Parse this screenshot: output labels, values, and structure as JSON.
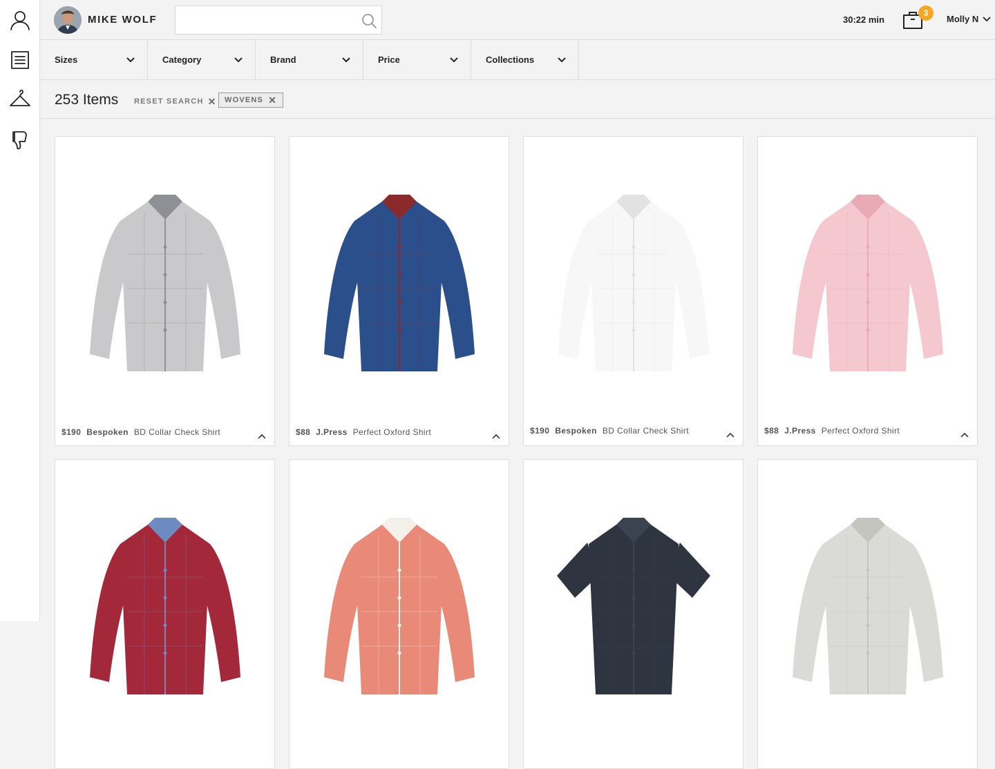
{
  "client": {
    "name": "MIKE WOLF"
  },
  "search": {
    "value": "",
    "placeholder": ""
  },
  "session": {
    "timer": "30:22 min"
  },
  "cart": {
    "count": "3"
  },
  "user": {
    "name": "Molly N"
  },
  "filters": [
    {
      "label": "Sizes"
    },
    {
      "label": "Category"
    },
    {
      "label": "Brand"
    },
    {
      "label": "Price"
    },
    {
      "label": "Collections"
    }
  ],
  "results": {
    "count_label": "253 Items",
    "reset_label": "RESET SEARCH",
    "chips": [
      {
        "label": "WOVENS"
      }
    ]
  },
  "icons": {
    "rail": [
      "client-icon",
      "notes-icon",
      "hanger-icon",
      "dislike-icon"
    ],
    "search": "search-icon",
    "cart": "bag-icon"
  },
  "colors": {
    "badge": "#f5a623",
    "background": "#f3f3f3",
    "border": "#dcdcdc"
  },
  "products": [
    {
      "price": "$190",
      "brand": "Bespoken",
      "name": "BD Collar Check Shirt",
      "swatch": "#c9c9cc",
      "accent": "#8f8f96"
    },
    {
      "price": "$88",
      "brand": "J.Press",
      "name": "Perfect Oxford Shirt",
      "swatch": "#2a4f8a",
      "accent": "#8b2a2a"
    },
    {
      "price": "$190",
      "brand": "Bespoken",
      "name": "BD Collar Check Shirt",
      "swatch": "#f7f7f7",
      "accent": "#e2e2e2"
    },
    {
      "price": "$88",
      "brand": "J.Press",
      "name": "Perfect Oxford Shirt",
      "swatch": "#f5c7cf",
      "accent": "#e8aab5"
    },
    {
      "price": "",
      "brand": "",
      "name": "",
      "swatch": "#a3283a",
      "accent": "#6d8bc0"
    },
    {
      "price": "",
      "brand": "",
      "name": "",
      "swatch": "#e98a78",
      "accent": "#f4f0ea"
    },
    {
      "price": "",
      "brand": "",
      "name": "",
      "swatch": "#2e3440",
      "accent": "#3b4250"
    },
    {
      "price": "",
      "brand": "",
      "name": "",
      "swatch": "#dadbd6",
      "accent": "#c4c5bf"
    }
  ]
}
